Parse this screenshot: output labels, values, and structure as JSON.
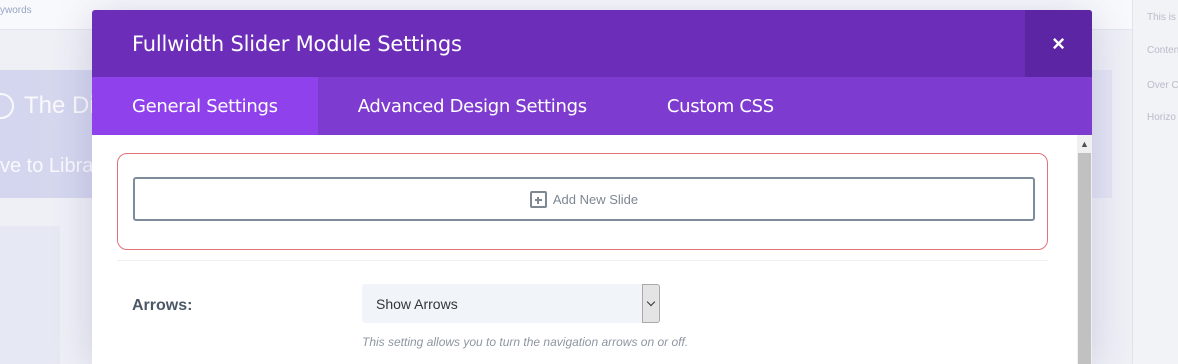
{
  "background": {
    "keywords_text": "ywords",
    "hero_title": "The Divi",
    "hero_subtitle": "ve to Librar",
    "right_panel_items": [
      "This is",
      "Conten",
      "Over C",
      "Horizo"
    ]
  },
  "modal": {
    "title": "Fullwidth Slider Module Settings",
    "close_label": "×",
    "tabs": [
      {
        "label": "General Settings",
        "active": true
      },
      {
        "label": "Advanced Design Settings",
        "active": false
      },
      {
        "label": "Custom CSS",
        "active": false
      }
    ],
    "add_slide_label": "Add New Slide",
    "fields": [
      {
        "label": "Arrows:",
        "selected_value": "Show Arrows",
        "description": "This setting allows you to turn the navigation arrows on or off."
      }
    ]
  },
  "colors": {
    "header": "#6c2eb9",
    "tab_bar": "#7e3bd0",
    "active_tab": "#8f42ec",
    "close_button": "#5c25a4",
    "slides_border": "#e0737a"
  }
}
